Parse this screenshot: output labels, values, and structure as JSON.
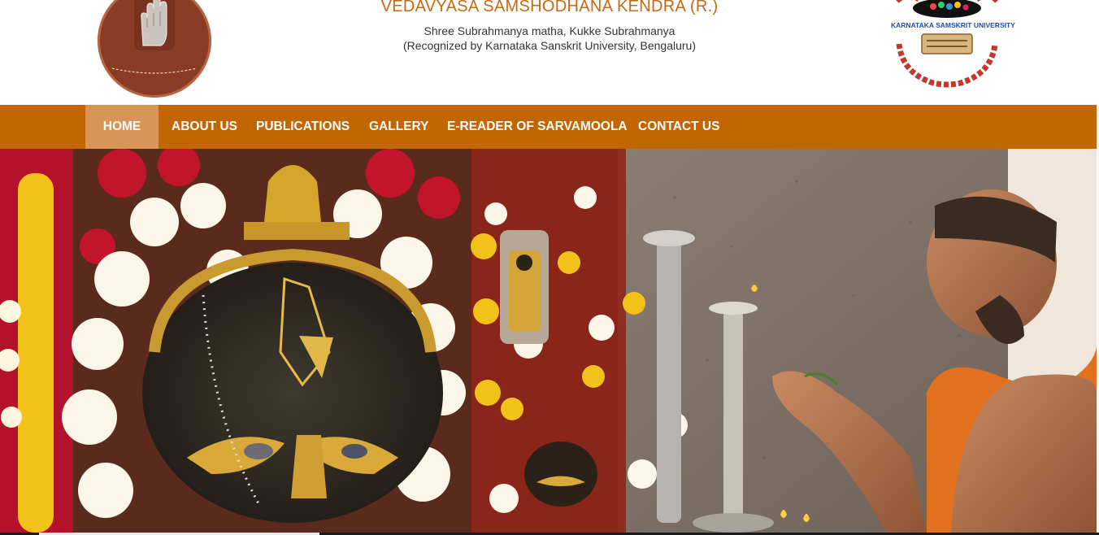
{
  "header": {
    "title": "VEDAVYASA SAMSHODHANA KENDRA (R.)",
    "subtitle_line1": "Shree Subrahmanya matha, Kukke Subrahmanya",
    "subtitle_line2": "(Recognized by Karnataka Sanskrit University, Bengaluru)",
    "right_logo_text": "KARNATAKA SAMSKRIT UNIVERSITY"
  },
  "nav": {
    "items": [
      {
        "label": "HOME",
        "active": true
      },
      {
        "label": "ABOUT US"
      },
      {
        "label": "PUBLICATIONS"
      },
      {
        "label": "GALLERY"
      },
      {
        "label": "E-READER OF SARVAMOOLA"
      },
      {
        "label": "CONTACT US"
      }
    ]
  },
  "colors": {
    "nav_background": "#c16602",
    "nav_active": "#d99556",
    "title": "#c56a12",
    "logo_maroon": "#8a3b25"
  },
  "banner": {
    "image": "temple-deity-and-priest-photo"
  }
}
